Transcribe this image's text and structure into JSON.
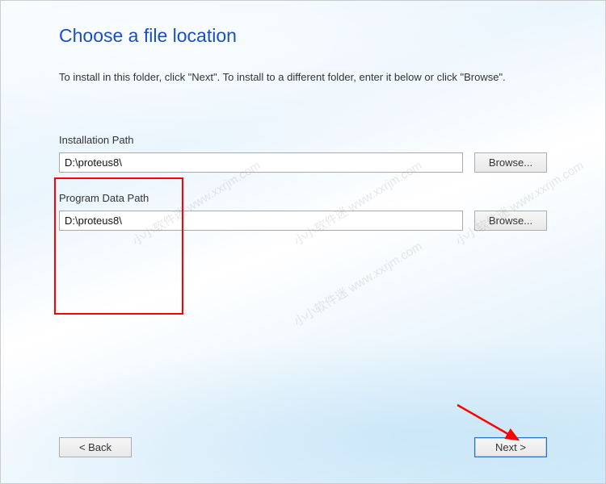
{
  "title": "Choose a file location",
  "instruction": "To install in this folder, click \"Next\". To install to a different folder, enter it below or click \"Browse\".",
  "installPath": {
    "label": "Installation Path",
    "value": "D:\\proteus8\\",
    "browse": "Browse..."
  },
  "dataPath": {
    "label": "Program Data Path",
    "value": "D:\\proteus8\\",
    "browse": "Browse..."
  },
  "nav": {
    "back": "< Back",
    "next": "Next >"
  },
  "watermark": "小小软件迷 www.xxrjm.com"
}
